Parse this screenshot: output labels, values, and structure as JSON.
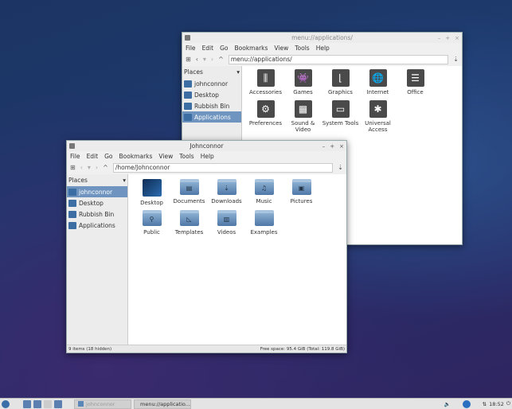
{
  "windows": {
    "apps": {
      "title": "menu://applications/",
      "menu": [
        "File",
        "Edit",
        "Go",
        "Bookmarks",
        "View",
        "Tools",
        "Help"
      ],
      "path": "menu://applications/",
      "places_label": "Places",
      "places": [
        "johnconnor",
        "Desktop",
        "Rubbish Bin",
        "Applications"
      ],
      "selected": "Applications",
      "items": [
        {
          "label": "Accessories",
          "icon": "accessories-icon",
          "glyph": "⫼"
        },
        {
          "label": "Games",
          "icon": "games-icon",
          "glyph": "👾"
        },
        {
          "label": "Graphics",
          "icon": "graphics-icon",
          "glyph": "⌊"
        },
        {
          "label": "Internet",
          "icon": "globe-icon",
          "glyph": "🌐"
        },
        {
          "label": "Office",
          "icon": "office-icon",
          "glyph": "☰"
        },
        {
          "label": "Preferences",
          "icon": "gear-icon",
          "glyph": "⚙"
        },
        {
          "label": "Sound & Video",
          "icon": "film-icon",
          "glyph": "▦"
        },
        {
          "label": "System Tools",
          "icon": "monitor-icon",
          "glyph": "▭"
        },
        {
          "label": "Universal Access",
          "icon": "accessibility-icon",
          "glyph": "✱"
        }
      ]
    },
    "home": {
      "title": "Johnconnor",
      "menu": [
        "File",
        "Edit",
        "Go",
        "Bookmarks",
        "View",
        "Tools",
        "Help"
      ],
      "path": "/home/Johnconnor",
      "places_label": "Places",
      "places": [
        "johnconnor",
        "Desktop",
        "Rubbish Bin",
        "Applications"
      ],
      "selected": "johnconnor",
      "items": [
        {
          "label": "Desktop",
          "glyph": ""
        },
        {
          "label": "Documents",
          "glyph": "▤"
        },
        {
          "label": "Downloads",
          "glyph": "⇣"
        },
        {
          "label": "Music",
          "glyph": "♫"
        },
        {
          "label": "Pictures",
          "glyph": "▣"
        },
        {
          "label": "Public",
          "glyph": "⚲"
        },
        {
          "label": "Templates",
          "glyph": "◺"
        },
        {
          "label": "Videos",
          "glyph": "▥"
        },
        {
          "label": "Examples",
          "glyph": ""
        }
      ],
      "status_left": "9 items (18 hidden)",
      "status_right": "Free space: 95.4 GiB (Total: 119.8 GiB)"
    }
  },
  "taskbar": {
    "tasks": [
      "johnconnor",
      "menu://applicatio..."
    ],
    "clock": "18:52"
  }
}
